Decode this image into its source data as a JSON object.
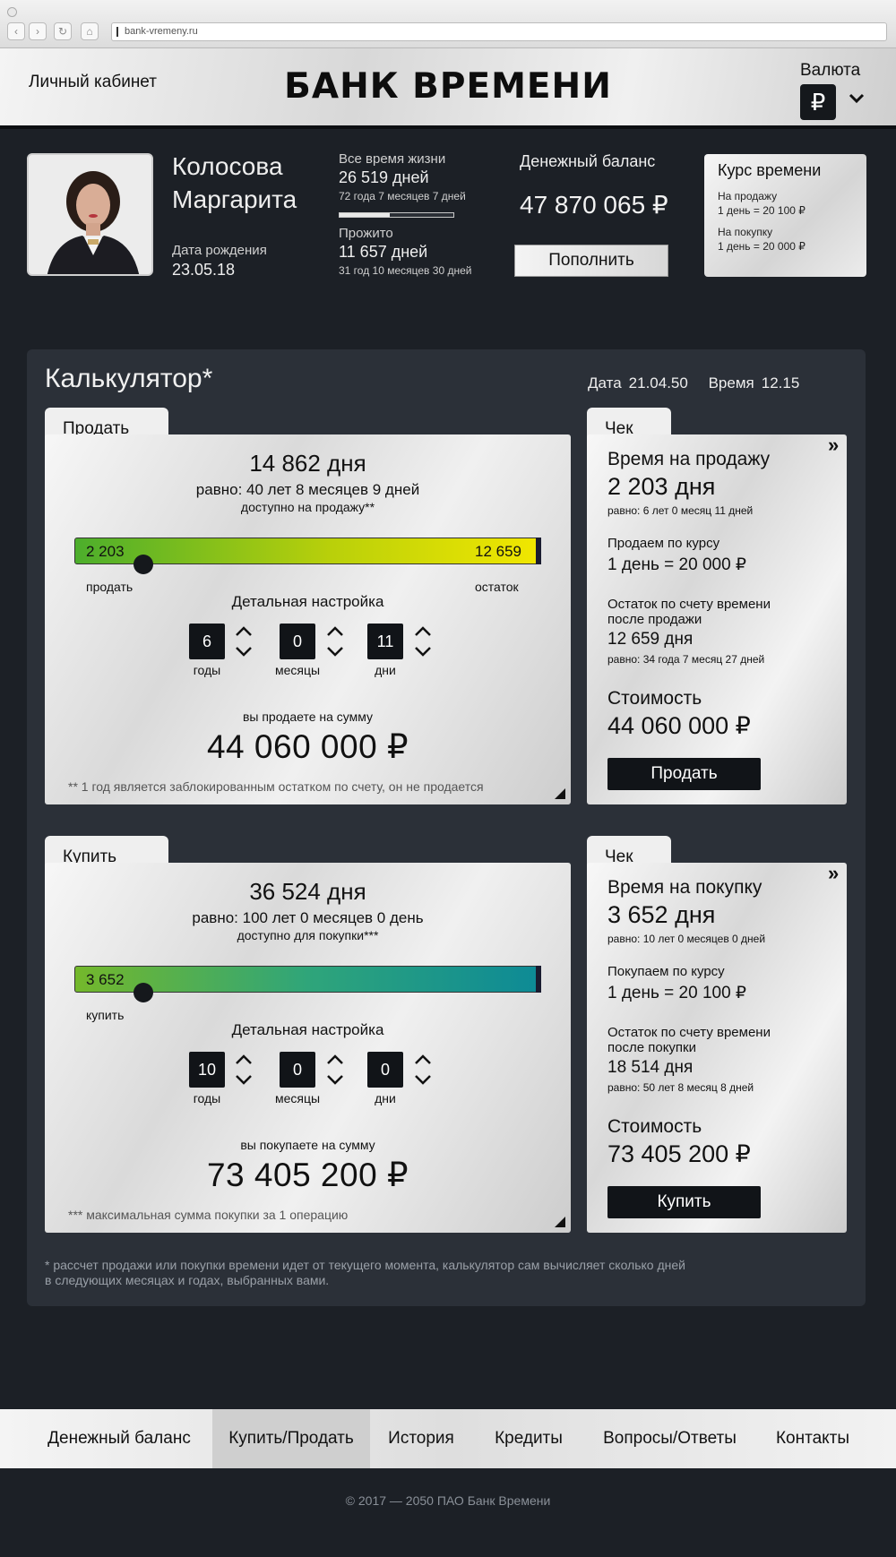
{
  "browser": {
    "url": "bank-vremeny.ru"
  },
  "header": {
    "cabinet_link": "Личный кабинет",
    "logo": "БАНК ВРЕМЕНИ",
    "currency_label": "Валюта",
    "currency_symbol": "₽"
  },
  "profile": {
    "surname": "Колосова",
    "name": "Маргарита",
    "birth_label": "Дата рождения",
    "birth_date": "23.05.18",
    "lifetime_label": "Все время жизни",
    "lifetime_days": "26 519 дней",
    "lifetime_detail": "72 года 7 месяцев 7 дней",
    "lived_fraction": 0.44,
    "lived_label": "Прожито",
    "lived_days": "11 657 дней",
    "lived_detail": "31 год 10 месяцев 30 дней",
    "balance_label": "Денежный баланс",
    "balance_value": "47 870 065 ₽",
    "topup_button": "Пополнить"
  },
  "rate": {
    "title": "Курс времени",
    "sell_label": "На продажу",
    "sell_value": "1 день = 20 100 ₽",
    "buy_label": "На покупку",
    "buy_value": "1 день = 20 000 ₽"
  },
  "calculator": {
    "title": "Калькулятор*",
    "date_label": "Дата",
    "date": "21.04.50",
    "time_label": "Время",
    "time": "12.15",
    "disclaimer_1": "* рассчет продажи или покупки времени идет от текущего момента, калькулятор сам вычисляет сколько дней",
    "disclaimer_2": "в следующих месяцах и годах, выбранных вами.",
    "sell": {
      "tab": "Продать",
      "days": "14 862 дня",
      "equals": "равно: 40 лет  8 месяцев 9 дней",
      "available": "доступно на продажу**",
      "slider_left": "2 203",
      "slider_right": "12 659",
      "slider_fraction": 0.148,
      "label_left": "продать",
      "label_right": "остаток",
      "detail_title": "Детальная настройка",
      "years": "6",
      "months": "0",
      "days_n": "11",
      "unit_years": "годы",
      "unit_months": "месяцы",
      "unit_days": "дни",
      "sum_label": "вы продаете на сумму",
      "sum": "44 060 000 ₽",
      "note": "** 1 год является заблокированным остатком по счету, он не продается"
    },
    "sell_check": {
      "tab": "Чек",
      "arrow": "»",
      "h1": "Время на продажу",
      "v1": "2 203 дня",
      "s1": "равно:  6 лет  0 месяц  11 дней",
      "m2": "Продаем по курсу",
      "v2": "1 день = 20 000 ₽",
      "m3a": "Остаток по счету времени",
      "m3b": "после продажи",
      "v3": "12 659 дня",
      "s3": "равно:  34 года  7 месяц  27 дней",
      "h4": "Стоимость",
      "v4": "44 060 000 ₽",
      "button": "Продать"
    },
    "buy": {
      "tab": "Купить",
      "days": "36 524 дня",
      "equals": "равно: 100 лет  0 месяцев  0 день",
      "available": "доступно для покупки***",
      "slider_left": "3 652",
      "slider_fraction": 0.148,
      "label_left": "купить",
      "detail_title": "Детальная настройка",
      "years": "10",
      "months": "0",
      "days_n": "0",
      "unit_years": "годы",
      "unit_months": "месяцы",
      "unit_days": "дни",
      "sum_label": "вы покупаете на сумму",
      "sum": "73 405 200 ₽",
      "note": "*** максимальная сумма покупки за 1 операцию"
    },
    "buy_check": {
      "tab": "Чек",
      "arrow": "»",
      "h1": "Время на покупку",
      "v1": "3 652 дня",
      "s1": "равно:  10 лет  0 месяцев  0 дней",
      "m2": "Покупаем по курсу",
      "v2": "1 день = 20 100 ₽",
      "m3a": "Остаток по счету времени",
      "m3b": "после покупки",
      "v3": "18 514 дня",
      "s3": "равно:  50 лет  8 месяц  8 дней",
      "h4": "Стоимость",
      "v4": "73 405 200 ₽",
      "button": "Купить"
    }
  },
  "nav": {
    "items": [
      "Денежный баланс",
      "Купить/Продать",
      "История",
      "Кредиты",
      "Вопросы/Ответы",
      "Контакты"
    ],
    "active": "Купить/Продать"
  },
  "footer": {
    "copyright": "© 2017 — 2050 ПАО Банк Времени"
  },
  "colors": {
    "dark_bg": "#1c2026",
    "panel_bg": "#2b3038",
    "sell_gradient": [
      "#4cae2c",
      "#b9d00a",
      "#f2e700"
    ],
    "buy_gradient": [
      "#74b82b",
      "#1a9a86",
      "#0d8a96"
    ]
  }
}
